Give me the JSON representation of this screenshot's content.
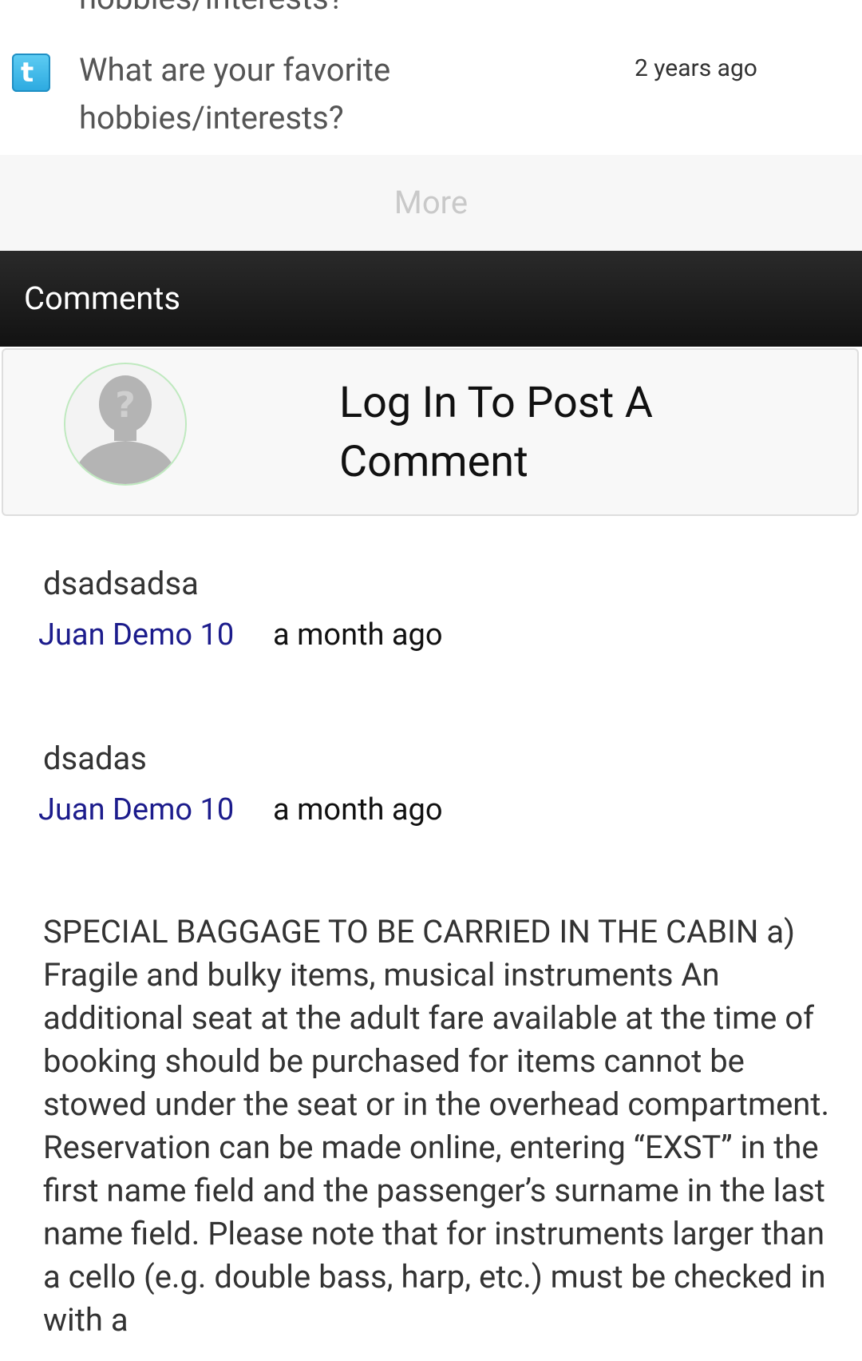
{
  "activity": {
    "cut_title": "hobbies/interests?",
    "item": {
      "icon": "twitter-icon",
      "title": "What are your favorite hobbies/interests?",
      "time": "2 years ago"
    },
    "more_label": "More"
  },
  "comments_section": {
    "header": "Comments",
    "login_prompt": "Log In To Post A Comment",
    "avatar_icon": "unknown-user-icon"
  },
  "comments": [
    {
      "body": "dsadsadsa",
      "author": "Juan Demo 10",
      "time": "a month ago"
    },
    {
      "body": "dsadas",
      "author": "Juan Demo 10",
      "time": "a month ago"
    }
  ],
  "long_comment": {
    "body": "SPECIAL BAGGAGE TO BE CARRIED IN THE CABIN a) Fragile and bulky items, musical instruments An additional seat at the adult fare available at the time of booking should be purchased for items cannot be stowed under the seat or in the overhead compartment. Reservation can be made online, entering “EXST” in the first name field and the passenger’s surname in the last name field. Please note that for instruments larger than a cello (e.g. double bass, harp, etc.) must be checked in with a"
  },
  "colors": {
    "header_bg": "#1a1a1a",
    "author_link": "#1c1c8c",
    "more_text": "#c9c9c9",
    "twitter_blue": "#2ba9e0"
  }
}
